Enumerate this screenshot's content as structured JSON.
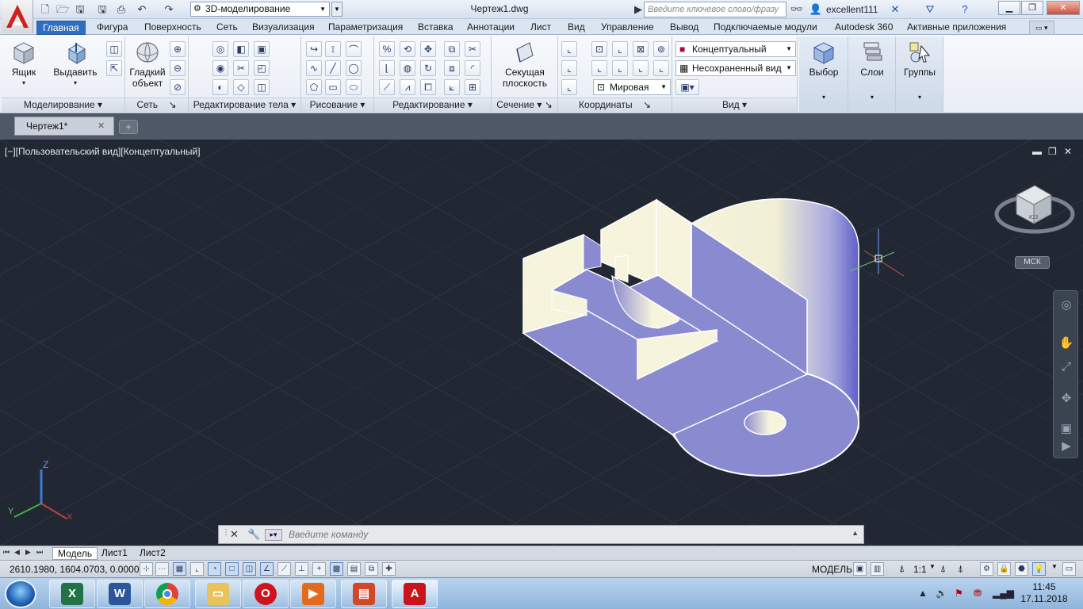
{
  "title_bar": {
    "workspace": "3D-моделирование",
    "document": "Чертеж1.dwg",
    "search_placeholder": "Введите ключевое слово/фразу",
    "user": "excellent111"
  },
  "ribbon": {
    "tabs": [
      "Главная",
      "Фигура",
      "Поверхность",
      "Сеть",
      "Визуализация",
      "Параметризация",
      "Вставка",
      "Аннотации",
      "Лист",
      "Вид",
      "Управление",
      "Вывод",
      "Подключаемые модули",
      "Autodesk 360",
      "Активные приложения"
    ],
    "active_tab": "Главная",
    "buttons": {
      "box": "Ящик",
      "extrude": "Выдавить",
      "smooth": "Гладкий объект",
      "section_plane": "Секущая плоскость",
      "selection": "Выбор",
      "layers": "Слои",
      "groups": "Группы"
    },
    "dropdowns": {
      "visual_style": "Концептуальный",
      "named_view": "Несохраненный вид",
      "coord_system": "Мировая"
    },
    "panels": {
      "modeling": "Моделирование",
      "mesh": "Сеть",
      "solid_edit": "Редактирование тела",
      "draw": "Рисование",
      "modify": "Редактирование",
      "section": "Сечение",
      "coordinates": "Координаты",
      "view": "Вид"
    }
  },
  "file_tabs": [
    {
      "label": "Чертеж1*",
      "close": "✕"
    }
  ],
  "viewport": {
    "label": "[−][Пользовательский вид][Концептуальный]",
    "wcs_badge": "МСК",
    "viewcube_face": "ЮЗ",
    "ucs_axes": {
      "x": "X",
      "y": "Y",
      "z": "Z"
    }
  },
  "command_line": {
    "placeholder": "Введите  команду"
  },
  "layout_tabs": [
    "Модель",
    "Лист1",
    "Лист2"
  ],
  "active_layout": "Модель",
  "status_bar": {
    "coordinates": "2610.1980, 1604.0703, 0.0000",
    "space": "МОДЕЛЬ",
    "scale": "1:1"
  },
  "taskbar": {
    "time": "11:45",
    "date": "17.11.2018"
  },
  "colors": {
    "ribbon_active_tab": "#2f6ec1",
    "viewport_bg": "#212833",
    "model_face": "#8a8ad0",
    "model_highlight": "#f6f4dc"
  }
}
